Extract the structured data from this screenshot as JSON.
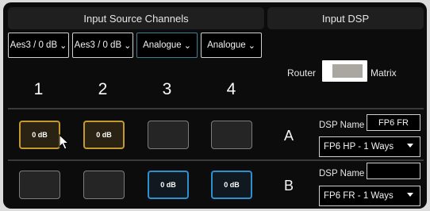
{
  "headers": {
    "input_source_channels": "Input Source Channels",
    "input_dsp": "Input DSP"
  },
  "sources": [
    {
      "label": "Aes3 / 0 dB"
    },
    {
      "label": "Aes3 / 0 dB"
    },
    {
      "label": "Analogue"
    },
    {
      "label": "Analogue"
    }
  ],
  "channel_numbers": [
    "1",
    "2",
    "3",
    "4"
  ],
  "routing": {
    "router_label": "Router",
    "matrix_label": "Matrix",
    "mode": "Router"
  },
  "rows": [
    {
      "label": "A",
      "slots": [
        "0 dB",
        "0 dB",
        "",
        ""
      ],
      "slot_states": [
        "gold",
        "gold",
        "empty",
        "empty"
      ],
      "dsp_name_label": "DSP Name",
      "dsp_name_value": "FP6 FR",
      "preset": "FP6 HP - 1 Ways"
    },
    {
      "label": "B",
      "slots": [
        "",
        "",
        "0 dB",
        "0 dB"
      ],
      "slot_states": [
        "empty",
        "empty",
        "blue",
        "blue"
      ],
      "dsp_name_label": "DSP Name",
      "dsp_name_value": "",
      "preset": "FP6 FR - 1 Ways"
    }
  ],
  "colors": {
    "active_gold": "#c49a2c",
    "active_blue": "#2e8fcf",
    "select_teal": "#3f7f91"
  },
  "icons": {
    "dropdown": "chevron-down-icon",
    "pointer": "mouse-pointer-icon"
  }
}
